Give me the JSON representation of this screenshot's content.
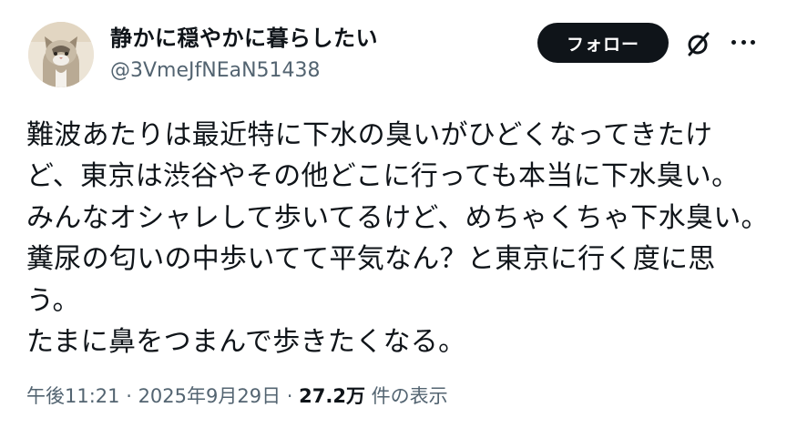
{
  "author": {
    "display_name": "静かに穏やかに暮らしたい",
    "handle": "@3VmeJfNEaN51438",
    "avatar_icon": "cat-avatar"
  },
  "actions": {
    "follow_label": "フォロー",
    "grok_icon": "grok-icon",
    "more_icon": "more-dots-icon"
  },
  "tweet": {
    "lines": [
      "難波あたりは最近特に下水の臭いがひどくなってきたけ",
      "ど、東京は渋谷やその他どこに行っても本当に下水臭い。",
      "みんなオシャレして歩いてるけど、めちゃくちゃ下水臭い。",
      "糞尿の匂いの中歩いてて平気なん？と東京に行く度に思",
      "う。",
      "たまに鼻をつまんで歩きたくなる。"
    ]
  },
  "meta": {
    "time": "午後11:21",
    "separator1": " · ",
    "date": "2025年9月29日",
    "separator2": " · ",
    "views_count": "27.2万",
    "views_label": " 件の表示"
  },
  "colors": {
    "text": "#0f1419",
    "secondary": "#536471",
    "button_bg": "#0f1419",
    "button_text": "#ffffff"
  }
}
